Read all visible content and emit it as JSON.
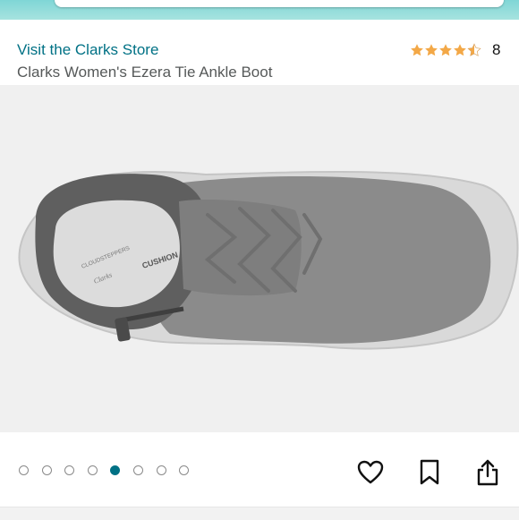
{
  "header": {
    "store_link": "Visit the Clarks Store",
    "product_title": "Clarks Women's Ezera Tie Ankle Boot"
  },
  "rating": {
    "stars": 4.5,
    "max_stars": 5,
    "review_count": "8",
    "star_color": "#f3a847"
  },
  "image": {
    "insole_brand": "CLOUDSTEPPERS",
    "insole_maker": "Clarks",
    "insole_tag": "CUSHION",
    "background_color": "#f0f0f0"
  },
  "carousel": {
    "dot_count": 8,
    "active_index": 4,
    "active_color": "#007185"
  },
  "actions": [
    {
      "name": "favorite",
      "icon": "heart-icon"
    },
    {
      "name": "save",
      "icon": "bookmark-icon"
    },
    {
      "name": "share",
      "icon": "share-icon"
    }
  ],
  "colors": {
    "link": "#007185",
    "title": "#565959",
    "top_bar": "#8fdcd8"
  }
}
